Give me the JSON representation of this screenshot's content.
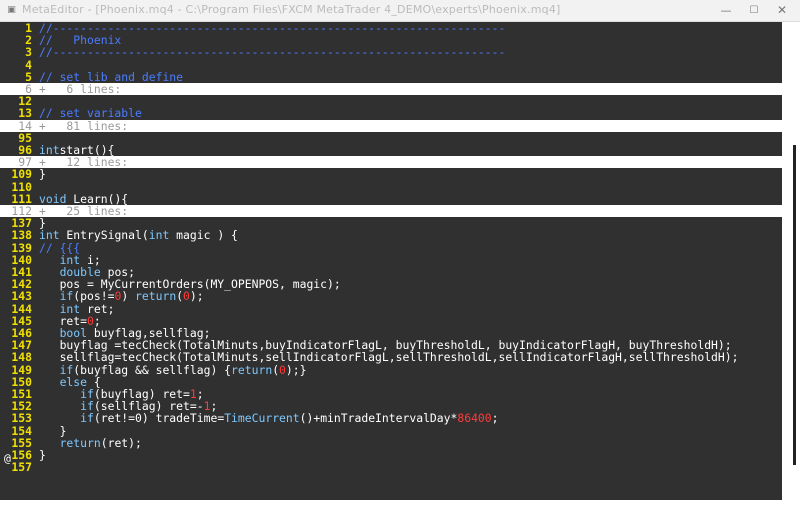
{
  "window": {
    "title": "MetaEditor - [Phoenix.mq4 - C:\\Program Files\\FXCM MetaTrader 4_DEMO\\experts\\Phoenix.mq4]",
    "min_glyph": "—",
    "max_glyph": "☐",
    "close_glyph": "✕"
  },
  "colors": {
    "background": "#303030",
    "line_number": "#f0e000",
    "keyword": "#7ec8ff",
    "comment": "#4a7cff",
    "number": "#ff3a3a",
    "fold_row": "#ffffff"
  },
  "rows": [
    {
      "n": "1",
      "t": [
        [
          "c",
          "//------------------------------------------------------------------"
        ]
      ]
    },
    {
      "n": "2",
      "t": [
        [
          "c",
          "//   Phoenix"
        ]
      ]
    },
    {
      "n": "3",
      "t": [
        [
          "c",
          "//------------------------------------------------------------------"
        ]
      ]
    },
    {
      "n": "4",
      "t": []
    },
    {
      "n": "5",
      "t": [
        [
          "c",
          "// set lib and define"
        ]
      ]
    },
    {
      "n": "6",
      "fold": true,
      "t": [
        [
          "f",
          "+   6 lines:"
        ]
      ]
    },
    {
      "n": "12",
      "t": []
    },
    {
      "n": "13",
      "t": [
        [
          "c",
          "// set variable"
        ]
      ]
    },
    {
      "n": "14",
      "fold": true,
      "t": [
        [
          "f",
          "+   81 lines:"
        ]
      ]
    },
    {
      "n": "95",
      "t": []
    },
    {
      "n": "96",
      "t": [
        [
          "k",
          "int"
        ],
        [
          "",
          "start(){"
        ]
      ]
    },
    {
      "n": "97",
      "fold": true,
      "t": [
        [
          "f",
          "+   12 lines:"
        ]
      ]
    },
    {
      "n": "109",
      "t": [
        [
          "",
          "}"
        ]
      ]
    },
    {
      "n": "110",
      "t": []
    },
    {
      "n": "111",
      "t": [
        [
          "k",
          "void"
        ],
        [
          "",
          " Learn(){"
        ]
      ]
    },
    {
      "n": "112",
      "fold": true,
      "t": [
        [
          "f",
          "+   25 lines:"
        ]
      ]
    },
    {
      "n": "137",
      "t": [
        [
          "",
          "}"
        ]
      ]
    },
    {
      "n": "138",
      "t": [
        [
          "k",
          "int"
        ],
        [
          "",
          " EntrySignal("
        ],
        [
          "k",
          "int"
        ],
        [
          "",
          " magic ) {"
        ]
      ]
    },
    {
      "n": "139",
      "t": [
        [
          "c",
          "// {{{"
        ]
      ]
    },
    {
      "n": "140",
      "t": [
        [
          "",
          "   "
        ],
        [
          "k",
          "int"
        ],
        [
          "",
          " i;"
        ]
      ]
    },
    {
      "n": "141",
      "t": [
        [
          "",
          "   "
        ],
        [
          "k",
          "double"
        ],
        [
          "",
          " pos;"
        ]
      ]
    },
    {
      "n": "142",
      "t": [
        [
          "",
          "   pos = MyCurrentOrders(MY_OPENPOS, magic);"
        ]
      ]
    },
    {
      "n": "143",
      "t": [
        [
          "",
          "   "
        ],
        [
          "k",
          "if"
        ],
        [
          "",
          "(pos!="
        ],
        [
          "n",
          "0"
        ],
        [
          "",
          ") "
        ],
        [
          "k",
          "return"
        ],
        [
          "",
          "("
        ],
        [
          "n",
          "0"
        ],
        [
          "",
          ");"
        ]
      ]
    },
    {
      "n": "144",
      "t": [
        [
          "",
          "   "
        ],
        [
          "k",
          "int"
        ],
        [
          "",
          " ret;"
        ]
      ]
    },
    {
      "n": "145",
      "t": [
        [
          "",
          "   ret="
        ],
        [
          "n",
          "0"
        ],
        [
          "",
          ";"
        ]
      ]
    },
    {
      "n": "146",
      "t": [
        [
          "",
          "   "
        ],
        [
          "k",
          "bool"
        ],
        [
          "",
          " buyflag,sellflag;"
        ]
      ]
    },
    {
      "n": "147",
      "t": [
        [
          "",
          "   buyflag =tecCheck(TotalMinuts,buyIndicatorFlagL, buyThresholdL, buyIndicatorFlagH, buyThresholdH);"
        ]
      ]
    },
    {
      "n": "148",
      "t": [
        [
          "",
          "   sellflag=tecCheck(TotalMinuts,sellIndicatorFlagL,sellThresholdL,sellIndicatorFlagH,sellThresholdH);"
        ]
      ]
    },
    {
      "n": "149",
      "t": [
        [
          "",
          "   "
        ],
        [
          "k",
          "if"
        ],
        [
          "",
          "(buyflag && sellflag) {"
        ],
        [
          "k",
          "return"
        ],
        [
          "",
          "("
        ],
        [
          "n",
          "0"
        ],
        [
          "",
          ");}"
        ]
      ]
    },
    {
      "n": "150",
      "t": [
        [
          "",
          "   "
        ],
        [
          "k",
          "else"
        ],
        [
          "",
          " {"
        ]
      ]
    },
    {
      "n": "151",
      "t": [
        [
          "",
          "      "
        ],
        [
          "k",
          "if"
        ],
        [
          "",
          "(buyflag) ret="
        ],
        [
          "n",
          "1"
        ],
        [
          "",
          ";"
        ]
      ]
    },
    {
      "n": "152",
      "t": [
        [
          "",
          "      "
        ],
        [
          "k",
          "if"
        ],
        [
          "",
          "(sellflag) ret=-"
        ],
        [
          "n",
          "1"
        ],
        [
          "",
          ";"
        ]
      ]
    },
    {
      "n": "153",
      "t": [
        [
          "",
          "      "
        ],
        [
          "k",
          "if"
        ],
        [
          "",
          "(ret!=0) tradeTime="
        ],
        [
          "k",
          "TimeCurrent"
        ],
        [
          "",
          "()+minTradeIntervalDay*"
        ],
        [
          "n",
          "86400"
        ],
        [
          "",
          ";"
        ]
      ]
    },
    {
      "n": "154",
      "t": [
        [
          "",
          "   }"
        ]
      ]
    },
    {
      "n": "155",
      "t": [
        [
          "",
          "   "
        ],
        [
          "k",
          "return"
        ],
        [
          "",
          "(ret);"
        ]
      ]
    },
    {
      "n": "156",
      "t": [
        [
          "",
          "}"
        ]
      ]
    },
    {
      "n": "157",
      "t": []
    }
  ],
  "cmdline": "@"
}
